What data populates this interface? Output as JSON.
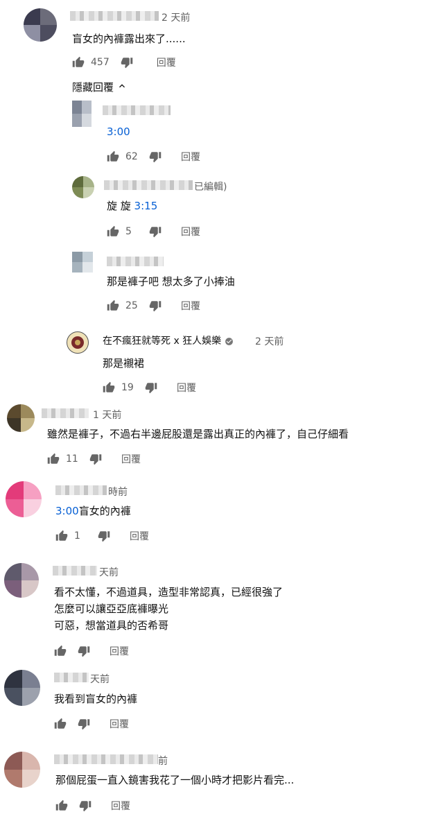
{
  "comments": [
    {
      "time": "2 天前",
      "text": "盲女的內褲露出來了......",
      "likes": "457",
      "reply": "回覆",
      "avatar_colors": [
        "#3b3b4f",
        "#6c6c7a",
        "#8e8fa3",
        "#4d4d5f"
      ]
    },
    {
      "time": "1 天前",
      "text": "雖然是褲子，不過右半邊屁股還是露出真正的內褲了，自己仔細看",
      "likes": "11",
      "reply": "回覆",
      "avatar_colors": [
        "#5b4a2e",
        "#9c8a5c",
        "#3d3527",
        "#c7b88a"
      ]
    },
    {
      "time": "時前",
      "ts": "3:00",
      "text": "盲女的內褲",
      "likes": "1",
      "reply": "回覆",
      "avatar_colors": [
        "#e33b7a",
        "#f6a0c2",
        "#ec5e95",
        "#f9d0e0"
      ]
    },
    {
      "time": "天前",
      "lines": [
        "看不太懂，不過道具，造型非常認真，已經很強了",
        "怎麼可以讓亞亞底褲曝光",
        "可惡，想當道具的否希哥"
      ],
      "likes": "",
      "reply": "回覆",
      "avatar_colors": [
        "#5f5a6c",
        "#a898a8",
        "#7b5f7b",
        "#d8c7c7"
      ]
    },
    {
      "time": "天前",
      "text": "我看到盲女的內褲",
      "likes": "",
      "reply": "回覆",
      "avatar_colors": [
        "#2f3340",
        "#7a7f91",
        "#4a5160",
        "#9ca1ad"
      ]
    },
    {
      "time": "前",
      "text": "那個屁蛋一直入鏡害我花了一個小時才把影片看完...",
      "likes": "",
      "reply": "回覆",
      "avatar_colors": [
        "#8d5a55",
        "#d9b6ad",
        "#b07a6d",
        "#e8d3cb"
      ]
    }
  ],
  "toggle": {
    "label": "隱藏回覆"
  },
  "replies": [
    {
      "time": "",
      "ts": "3:00",
      "text": "",
      "likes": "62",
      "reply": "回覆",
      "avatar_colors": [
        "#7c8494",
        "#b8bec9",
        "#9aa1ae",
        "#d5d9df"
      ]
    },
    {
      "time": "已編輯)",
      "prefix": "旋 旋 ",
      "ts": "3:15",
      "likes": "5",
      "reply": "回覆",
      "avatar_colors": [
        "#5e6b3c",
        "#a7b389",
        "#7d8b55",
        "#c9d1b2"
      ]
    },
    {
      "time": "",
      "text": "那是褲子吧 想太多了小捧油",
      "likes": "25",
      "reply": "回覆",
      "avatar_colors": [
        "#8c9aa6",
        "#c5d0d8",
        "#a6b3bd",
        "#e2e7eb"
      ]
    },
    {
      "author": "在不瘋狂就等死 x 狂人娛樂",
      "time": "2 天前",
      "text": "那是襯裙",
      "likes": "19",
      "reply": "回覆",
      "avatar_colors": [
        "#3a3a3a",
        "#c9a75a",
        "#7a2a2a",
        "#f0e2b8"
      ]
    }
  ],
  "icons": {
    "like": "thumb-up-icon",
    "dislike": "thumb-down-icon",
    "chevron": "chevron-up-icon",
    "verified": "verified-check-icon"
  }
}
